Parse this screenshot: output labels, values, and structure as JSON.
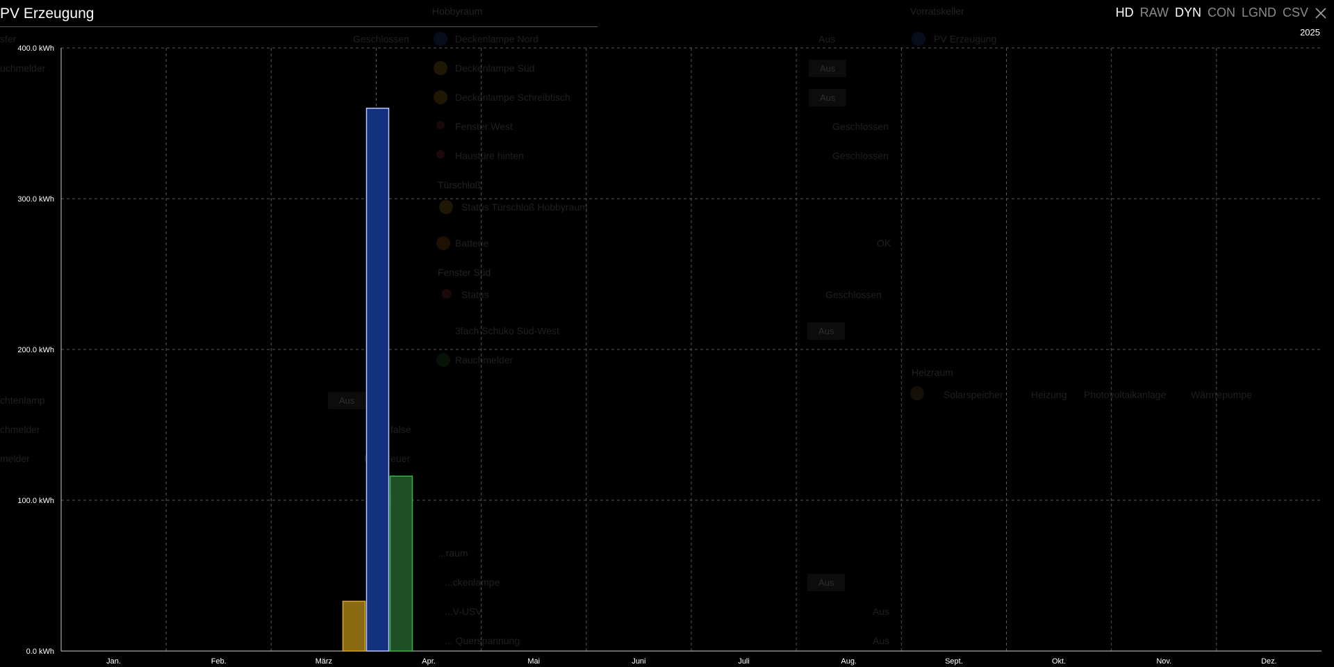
{
  "title": "PV Erzeugung",
  "year": "2025",
  "toolbar": {
    "buttons": [
      {
        "label": "HD",
        "active": true
      },
      {
        "label": "RAW",
        "active": false
      },
      {
        "label": "DYN",
        "active": true
      },
      {
        "label": "CON",
        "active": false
      },
      {
        "label": "LGND",
        "active": false
      },
      {
        "label": "CSV",
        "active": false
      }
    ],
    "close_icon": "close-icon"
  },
  "background": {
    "col1": {
      "partial_labels": [
        "sfer",
        "uchmelder",
        "chtenlamp",
        "chmelder",
        "melder"
      ],
      "values": [
        "Geschlossen",
        "Aus",
        "false",
        "kein Feuer"
      ]
    },
    "hobbyraum": {
      "title": "Hobbyraum",
      "rows": [
        {
          "label": "Deckenlampe Nord",
          "value": "Aus"
        },
        {
          "label": "Deckenlampe Süd",
          "value": "Aus"
        },
        {
          "label": "Deckenlampe Schreibtisch",
          "value": "Aus"
        },
        {
          "label": "Fenster West",
          "value": "Geschlossen"
        },
        {
          "label": "Haustüre hinten",
          "value": "Geschlossen"
        }
      ],
      "tuerschloss": {
        "section": "Türschloß",
        "status_label": "Status Türschloß Hobbyraum",
        "battery_label": "Batterie",
        "battery_value": "OK"
      },
      "fenster_sued": {
        "section": "Fenster Süd",
        "status_label": "Status",
        "status_value": "Geschlossen",
        "plug_label": "3fach Schuko Süd-West",
        "plug_value": "Aus",
        "smoke_label": "Rauchmelder"
      }
    },
    "lower_room": {
      "title": "...raum",
      "rows": [
        {
          "label": "...ckenlampe",
          "value": "Aus"
        },
        {
          "label": "...V-USV",
          "value": "Aus"
        },
        {
          "label": "... Querspannung",
          "value": "Aus"
        }
      ]
    },
    "vorratskeller": {
      "title": "Vorratskeller",
      "item": "PV Erzeugung"
    },
    "heizraum": {
      "title": "Heizraum",
      "items": [
        "Solarspeicher",
        "Heizung",
        "Photovoltaikanlage",
        "Wärmepumpe"
      ]
    }
  },
  "chart_data": {
    "type": "bar",
    "title": "PV Erzeugung",
    "year": "2025",
    "categories": [
      "Jan.",
      "Feb.",
      "März",
      "Apr.",
      "Mai",
      "Juni",
      "Juli",
      "Aug.",
      "Sept.",
      "Okt.",
      "Nov.",
      "Dez."
    ],
    "unit": "kWh",
    "ylim": [
      0,
      400
    ],
    "yticks": [
      0,
      100,
      200,
      300,
      400
    ],
    "ytick_labels": [
      "0.0 kWh",
      "100.0 kWh",
      "200.0 kWh",
      "300.0 kWh",
      "400.0 kWh"
    ],
    "grid": true,
    "legend": "none",
    "series": [
      {
        "values": [
          null,
          null,
          null,
          33,
          null,
          null,
          null,
          null,
          null,
          null,
          null,
          null
        ],
        "color": "#8a6a10",
        "border": "#d4a72c"
      },
      {
        "values": [
          null,
          null,
          null,
          360,
          null,
          null,
          null,
          null,
          null,
          null,
          null,
          null
        ],
        "color": "#12317f",
        "border": "#b8c8ff"
      },
      {
        "values": [
          null,
          null,
          null,
          116,
          null,
          null,
          null,
          null,
          null,
          null,
          null,
          null
        ],
        "color": "#1f4f24",
        "border": "#3fb34f"
      }
    ]
  }
}
